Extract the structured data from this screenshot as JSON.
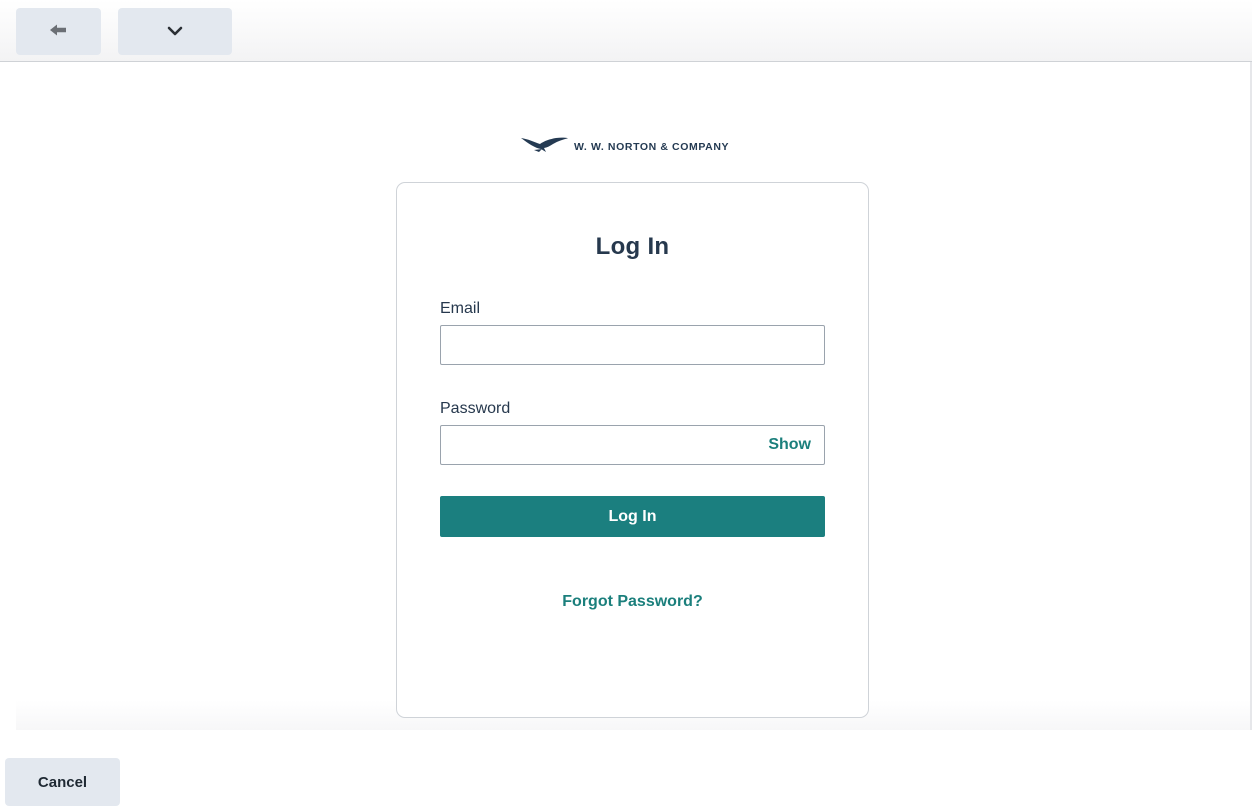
{
  "toolbar": {
    "back_icon": "arrow-left-icon",
    "menu_icon": "chevron-down-icon"
  },
  "logo": {
    "icon": "bird-logo-icon",
    "text": "W. W. NORTON & COMPANY"
  },
  "login_form": {
    "title": "Log In",
    "email_label": "Email",
    "email_value": "",
    "password_label": "Password",
    "password_value": "",
    "show_label": "Show",
    "submit_label": "Log In",
    "forgot_label": "Forgot Password?"
  },
  "footer": {
    "cancel_label": "Cancel"
  },
  "colors": {
    "accent": "#1b7f7f",
    "heading": "#26384d",
    "button_bg": "#e3e8ef"
  }
}
